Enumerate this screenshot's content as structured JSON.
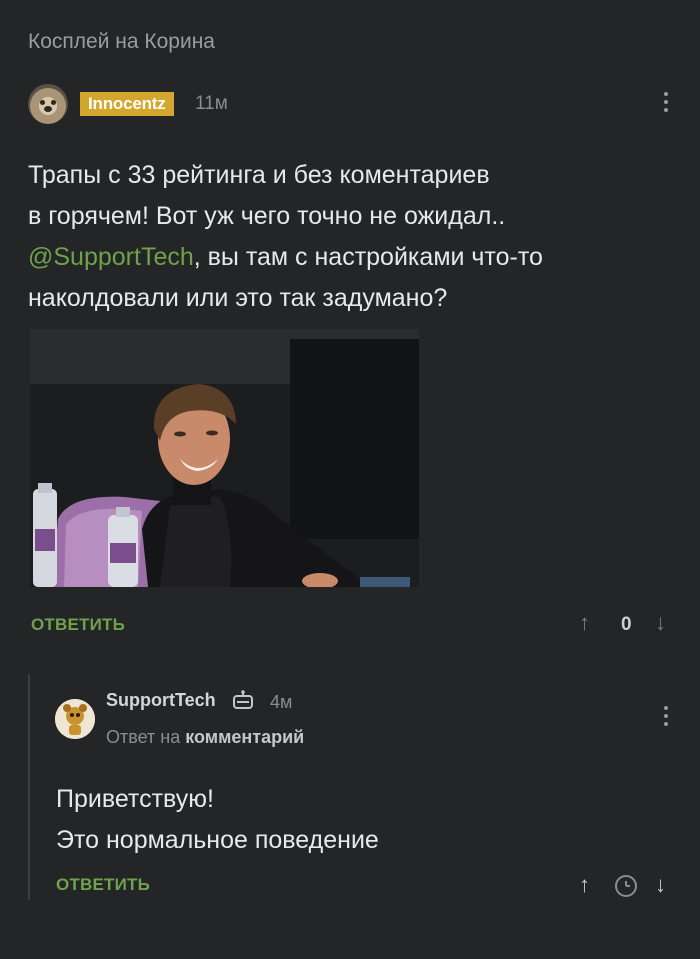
{
  "post": {
    "title": "Косплей на Корина",
    "author": "Innocentz",
    "time": "11м",
    "text_line1": "Трапы с 33 рейтинга и без коментариев",
    "text_line2": "в горячем! Вот уж чего точно не ожидал..",
    "mention": "@SupportTech",
    "text_line3_rest": ", вы там с настройками что-то",
    "text_line4": "наколдовали или это так задумано?",
    "reply_label": "ОТВЕТИТЬ",
    "score": "0"
  },
  "reply": {
    "author": "SupportTech",
    "time": "4м",
    "reply_to_prefix": "Ответ на",
    "reply_to_target": "комментарий",
    "line1": "Приветствую!",
    "line2": "Это нормальное поведение",
    "reply_label": "ОТВЕТИТЬ"
  },
  "icons": {
    "more": "more-vertical-icon",
    "upvote": "arrow-up-icon",
    "downvote": "arrow-down-icon",
    "clock": "clock-icon",
    "bot": "bot-icon"
  },
  "colors": {
    "accent_green": "#6fa24a",
    "badge_gold": "#d3a72d",
    "background": "#232527"
  }
}
